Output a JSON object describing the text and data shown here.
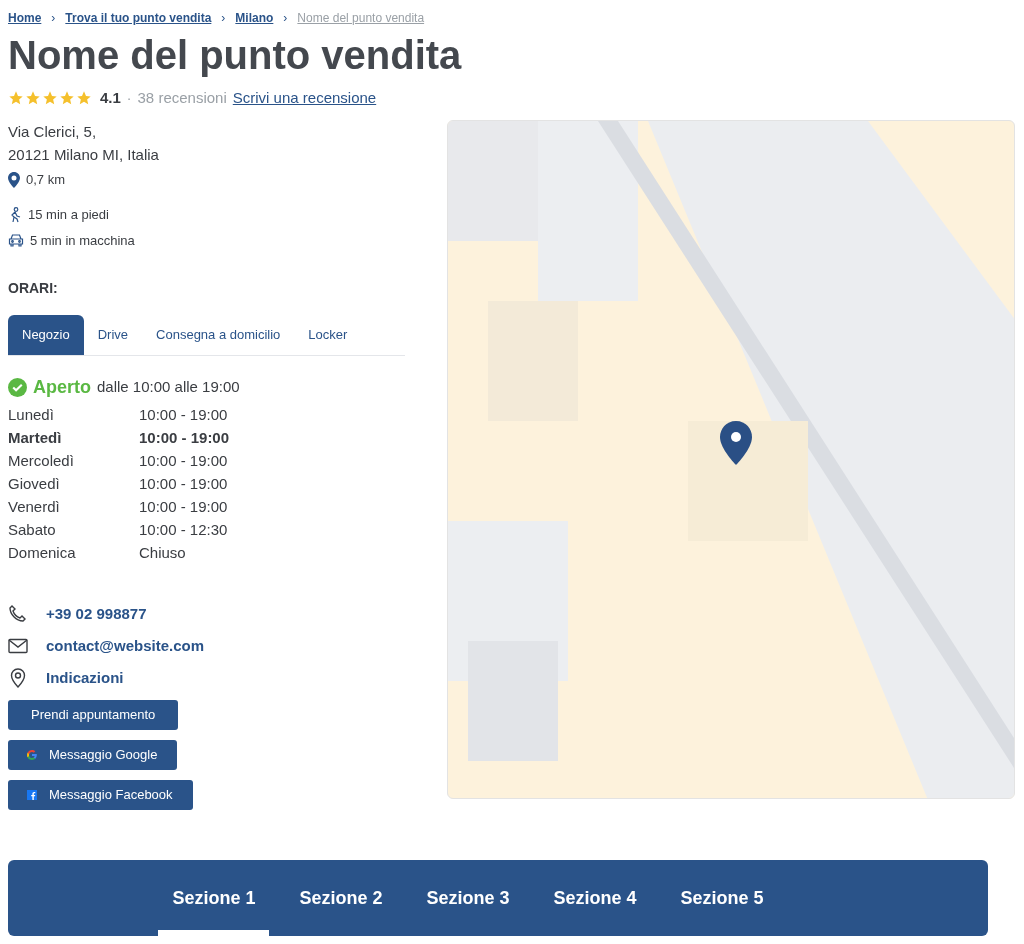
{
  "breadcrumb": [
    {
      "label": "Home",
      "link": true
    },
    {
      "label": "Trova il tuo punto vendita",
      "link": true
    },
    {
      "label": "Milano",
      "link": true
    },
    {
      "label": "Nome del punto vendita",
      "link": false
    }
  ],
  "breadcrumb_separator": "›",
  "title": "Nome del punto vendita",
  "rating": {
    "stars": 5,
    "score": "4.1",
    "separator": "·",
    "count": "38 recensioni",
    "write_link": "Scrivi una recensione"
  },
  "address": {
    "lines": [
      "Via Clerici, 5,",
      "20121 Milano MI, Italia"
    ],
    "distance": "0,7 km"
  },
  "travel": [
    {
      "kind": "walk",
      "label": "15 min a piedi"
    },
    {
      "kind": "car",
      "label": "5 min in macchina"
    }
  ],
  "hours_title": "ORARI:",
  "tabs": [
    {
      "label": "Negozio",
      "selected": true
    },
    {
      "label": "Drive",
      "selected": false
    },
    {
      "label": "Consegna a domicilio",
      "selected": false
    },
    {
      "label": "Locker",
      "selected": false
    }
  ],
  "status": {
    "open": true,
    "label": "Aperto",
    "detail": "dalle 10:00 alle 19:00"
  },
  "hours": [
    {
      "day": "Lunedì",
      "time": "10:00 - 19:00",
      "today": false
    },
    {
      "day": "Martedì",
      "time": "10:00 - 19:00",
      "today": true
    },
    {
      "day": "Mercoledì",
      "time": "10:00 - 19:00",
      "today": false
    },
    {
      "day": "Giovedì",
      "time": "10:00 - 19:00",
      "today": false
    },
    {
      "day": "Venerdì",
      "time": "10:00 - 19:00",
      "today": false
    },
    {
      "day": "Sabato",
      "time": "10:00 - 12:30",
      "today": false
    },
    {
      "day": "Domenica",
      "time": "Chiuso",
      "today": false
    }
  ],
  "contacts": [
    {
      "kind": "phone",
      "label": "+39 02 998877"
    },
    {
      "kind": "email",
      "label": "contact@website.com"
    },
    {
      "kind": "directions",
      "label": "Indicazioni"
    }
  ],
  "buttons": [
    {
      "kind": "plain",
      "label": "Prendi appuntamento"
    },
    {
      "kind": "google",
      "label": "Messaggio Google"
    },
    {
      "kind": "facebook",
      "label": "Messaggio Facebook"
    }
  ],
  "sections": [
    {
      "label": "Sezione 1",
      "selected": true
    },
    {
      "label": "Sezione 2",
      "selected": false
    },
    {
      "label": "Sezione 3",
      "selected": false
    },
    {
      "label": "Sezione 4",
      "selected": false
    },
    {
      "label": "Sezione 5",
      "selected": false
    }
  ]
}
